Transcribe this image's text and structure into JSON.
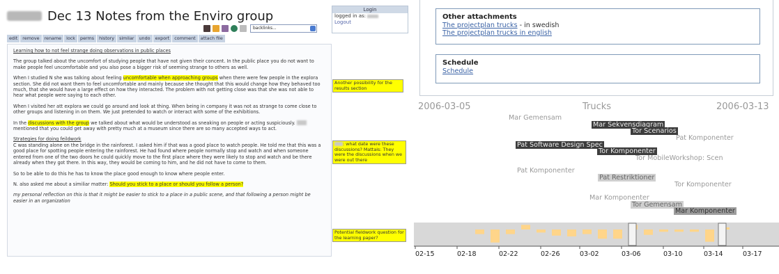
{
  "left": {
    "title": "Dec 13 Notes from the Enviro group",
    "login": {
      "header": "Login",
      "logged_label": "logged in as:",
      "logout": "Logout"
    },
    "backlinks_placeholder": "backlinks...",
    "actions": [
      "edit",
      "remove",
      "rename",
      "lock",
      "perms",
      "history",
      "similar",
      "undo",
      "export",
      "comment",
      "attach file"
    ],
    "heading": "Learning how to not feel strange doing observations in public places",
    "p1": "The group talked about the uncomfort of studying people that have not given their concent. In the public place you do not want to make people feel uncomfortable and you also pose a bigger risk of seeming strange to others as well.",
    "p2_a": "When I studied N she was talking about feeling ",
    "p2_hl": "uncomfortable when approaching groups",
    "p2_b": " when there were few people in the explora section. She did not want them to feel uncomfortable and mainly because she thought that this would change how they behaved too much, that she would have a large effect on how they interacted. The problem with not getting close was that she was not able to hear what people were saying to each other.",
    "p3": "When I visited her att explora we could go around and look at thing. When being in company it was not as strange to come close to other groups and listening in on them. We just pretended to watch or interact with some of the exhibitions.",
    "p4_a": "In the ",
    "p4_hl": "discussions with the group",
    "p4_b": " we talked about what would be understood as sneaking on people or acting suspiciously.",
    "p4_c": " mentioned that you could get away with pretty much at a museum since there are so many accepted ways to act.",
    "sub": "Strategies for doing feildwork",
    "p5": "C was standing alone on the bridge in the rainforest. I asked him if that was a good place to watch people. He told me that this was a good place for spotting people entering the rainforest. He had found where people normally stop and watch and when someone entered from one of the two doors he could quickly move to the first place where they were likely to stop and watch and be there already when they got there. In this way, they would be coming to him, and he did not have to come to them.",
    "p6": "So to be able to do this he has to know the place good enough to know where people enter.",
    "p7_a": "N. also asked me about a similiar matter: ",
    "p7_hl": "Should you stick to a place or should you follow a person?",
    "p8": "my personal reflection on this is that it might be easier to stick to a place in a public scene, and that following a person might be easier in an organization",
    "notes": [
      "Another possibility for the results section",
      ": what date were these discussions? Mattais: They were the discussions when we were out there",
      "Potential fieldwork question for the learning paper?"
    ]
  },
  "right": {
    "other_attachments": {
      "heading": "Other attachments",
      "link1": "The projectplan trucks",
      "link1_suffix": " - in swedish",
      "link2": "The projectplan trucks in english"
    },
    "schedule": {
      "heading": "Schedule",
      "link": "Schedule"
    },
    "timeline": {
      "start_date": "2006-03-05",
      "title": "Trucks",
      "end_date": "2006-03-13",
      "events": [
        {
          "label": "Mar Gemensam",
          "style": "plain"
        },
        {
          "label": "Mar Sekvensdiagram",
          "style": "dark"
        },
        {
          "label": "Tor Scenarios",
          "style": "dark"
        },
        {
          "label": "Pat Komponenter",
          "style": "plain"
        },
        {
          "label": "Pat Software Design Spec",
          "style": "dark"
        },
        {
          "label": "Tor Komponenter",
          "style": "dark"
        },
        {
          "label": "Tor MobileWorkshop: Scen",
          "style": "plain"
        },
        {
          "label": "Pat Komponenter",
          "style": "plain"
        },
        {
          "label": "Pat Restriktioner",
          "style": "light"
        },
        {
          "label": "Tor Komponenter",
          "style": "plain"
        },
        {
          "label": "Mar Komponenter",
          "style": "plain"
        },
        {
          "label": "Tor Gemensam",
          "style": "light"
        },
        {
          "label": "Mar Komponenter",
          "style": "medium"
        }
      ],
      "axis_ticks": [
        "02-15",
        "02-18",
        "02-22",
        "02-26",
        "03-02",
        "03-06",
        "03-10",
        "03-14",
        "03-17"
      ],
      "overview_bars": [
        {
          "dir": "down",
          "level": 0.3
        },
        {
          "dir": "down",
          "level": 0.85
        },
        {
          "dir": "down",
          "level": 0.3
        },
        {
          "dir": "up",
          "level": 0.3
        },
        {
          "dir": "down",
          "level": 0.2
        },
        {
          "dir": "down",
          "level": 0.4
        },
        {
          "dir": "down",
          "level": 0.45
        },
        {
          "dir": "down",
          "level": 0.3
        },
        {
          "dir": "down",
          "level": 0.6
        },
        {
          "dir": "down",
          "level": 0.6
        },
        {
          "dir": "up",
          "level": 0.3
        },
        {
          "dir": "down",
          "level": 0.35
        },
        {
          "dir": "down",
          "level": 0.15
        },
        {
          "dir": "down",
          "level": 0.15
        },
        {
          "dir": "down",
          "level": 0.15
        },
        {
          "dir": "down",
          "level": 0.8
        },
        {
          "dir": "up",
          "level": 0.1
        }
      ],
      "colors": {
        "bar": "#ffd58a",
        "strip": "#d8d8d8",
        "dark_event": "#3d3d3d",
        "light_event": "#cfcfcf"
      }
    }
  }
}
